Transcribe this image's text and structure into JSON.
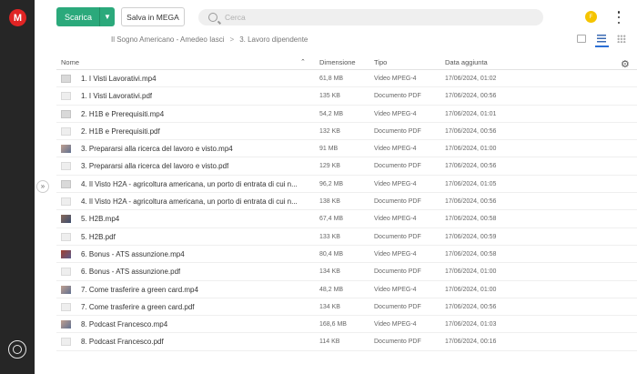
{
  "app": {
    "logo_letter": "M"
  },
  "toolbar": {
    "download_label": "Scarica",
    "save_label": "Salva in MEGA",
    "search_placeholder": "Cerca",
    "avatar_letter": "F"
  },
  "breadcrumb": [
    "Il Sogno Americano - Amedeo Iasci",
    "3. Lavoro dipendente"
  ],
  "table": {
    "headers": {
      "name": "Nome",
      "size": "Dimensione",
      "type": "Tipo",
      "date": "Data aggiunta"
    },
    "rows": [
      {
        "name": "1. I Visti Lavorativi.mp4",
        "size": "61,8 MB",
        "type": "Video MPEG-4",
        "date": "17/06/2024, 01:02",
        "icon": "video-thumbnail-icon"
      },
      {
        "name": "1. I Visti Lavorativi.pdf",
        "size": "135 KB",
        "type": "Documento PDF",
        "date": "17/06/2024, 00:56",
        "icon": "pdf-thumbnail-icon"
      },
      {
        "name": "2. H1B e Prerequisiti.mp4",
        "size": "54,2 MB",
        "type": "Video MPEG-4",
        "date": "17/06/2024, 01:01",
        "icon": "video-thumbnail-icon"
      },
      {
        "name": "2. H1B e Prerequisiti.pdf",
        "size": "132 KB",
        "type": "Documento PDF",
        "date": "17/06/2024, 00:56",
        "icon": "pdf-thumbnail-icon"
      },
      {
        "name": "3. Prepararsi alla ricerca del lavoro e visto.mp4",
        "size": "91 MB",
        "type": "Video MPEG-4",
        "date": "17/06/2024, 01:00",
        "icon": "video-thumbnail-icon"
      },
      {
        "name": "3. Prepararsi alla ricerca del lavoro e visto.pdf",
        "size": "129 KB",
        "type": "Documento PDF",
        "date": "17/06/2024, 00:56",
        "icon": "pdf-thumbnail-icon"
      },
      {
        "name": "4. Il Visto H2A - agricoltura americana, un porto di entrata di cui n...",
        "size": "96,2 MB",
        "type": "Video MPEG-4",
        "date": "17/06/2024, 01:05",
        "icon": "video-thumbnail-icon"
      },
      {
        "name": "4. Il Visto H2A - agricoltura americana, un porto di entrata di cui n...",
        "size": "138 KB",
        "type": "Documento PDF",
        "date": "17/06/2024, 00:56",
        "icon": "pdf-thumbnail-icon"
      },
      {
        "name": "5. H2B.mp4",
        "size": "67,4 MB",
        "type": "Video MPEG-4",
        "date": "17/06/2024, 00:58",
        "icon": "video-thumbnail-icon"
      },
      {
        "name": "5. H2B.pdf",
        "size": "133 KB",
        "type": "Documento PDF",
        "date": "17/06/2024, 00:59",
        "icon": "pdf-thumbnail-icon"
      },
      {
        "name": "6. Bonus - ATS assunzione.mp4",
        "size": "80,4 MB",
        "type": "Video MPEG-4",
        "date": "17/06/2024, 00:58",
        "icon": "video-thumbnail-icon"
      },
      {
        "name": "6. Bonus - ATS assunzione.pdf",
        "size": "134 KB",
        "type": "Documento PDF",
        "date": "17/06/2024, 01:00",
        "icon": "pdf-thumbnail-icon"
      },
      {
        "name": "7. Come trasferire a green card.mp4",
        "size": "48,2 MB",
        "type": "Video MPEG-4",
        "date": "17/06/2024, 01:00",
        "icon": "video-thumbnail-icon"
      },
      {
        "name": "7. Come trasferire a green card.pdf",
        "size": "134 KB",
        "type": "Documento PDF",
        "date": "17/06/2024, 00:56",
        "icon": "pdf-thumbnail-icon"
      },
      {
        "name": "8. Podcast Francesco.mp4",
        "size": "168,6 MB",
        "type": "Video MPEG-4",
        "date": "17/06/2024, 01:03",
        "icon": "video-thumbnail-icon"
      },
      {
        "name": "8. Podcast Francesco.pdf",
        "size": "114 KB",
        "type": "Documento PDF",
        "date": "17/06/2024, 00:16",
        "icon": "pdf-thumbnail-icon"
      }
    ]
  },
  "colors": {
    "accent_green": "#2ba97b",
    "brand_red": "#e02424",
    "rail_bg": "#262626",
    "active_view": "#2b6fd6"
  }
}
